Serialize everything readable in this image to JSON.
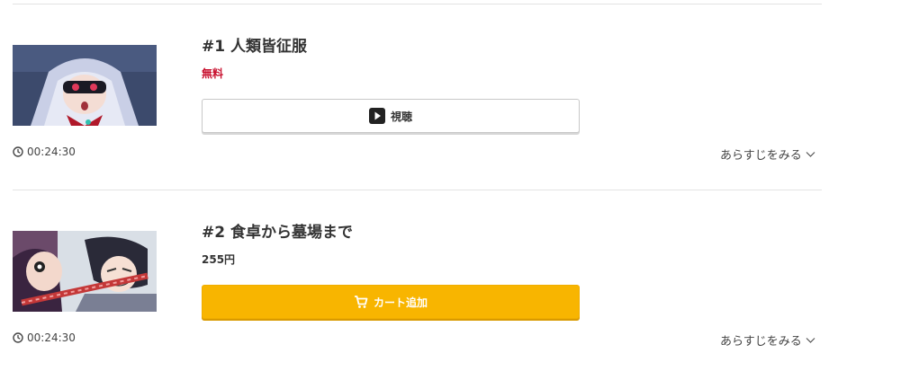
{
  "episodes": [
    {
      "title": "#1 人類皆征服",
      "price": "無料",
      "price_type": "free",
      "button_label": "視聴",
      "button_type": "watch",
      "duration": "00:24:30",
      "synopsis_label": "あらすじをみる"
    },
    {
      "title": "#2 食卓から墓場まで",
      "price": "255円",
      "price_type": "paid",
      "button_label": "カート追加",
      "button_type": "cart",
      "duration": "00:24:30",
      "synopsis_label": "あらすじをみる"
    }
  ],
  "colors": {
    "free_price": "#c8102e",
    "cart_button": "#f8b500",
    "divider": "#e3e3e3",
    "text": "#333333"
  },
  "icons": {
    "watch_button": "play-icon",
    "cart_button": "cart-icon",
    "duration": "clock-icon",
    "synopsis": "chevron-down-icon"
  }
}
